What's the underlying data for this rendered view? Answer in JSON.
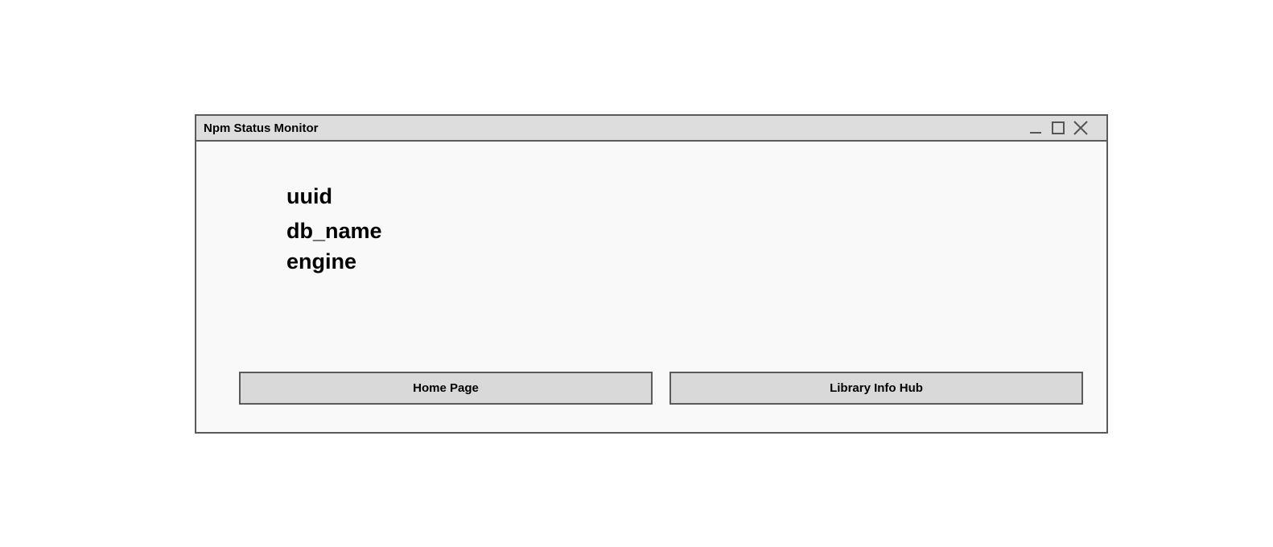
{
  "window": {
    "title": "Npm Status Monitor",
    "controls": {
      "minimize_icon": "minimize-icon",
      "maximize_icon": "maximize-icon",
      "close_icon": "close-icon"
    }
  },
  "main": {
    "fields": [
      "uuid",
      "db_name",
      "engine"
    ]
  },
  "buttons": {
    "home_label": "Home Page",
    "library_label": "Library Info Hub"
  },
  "colors": {
    "titlebar_bg": "#dddddd",
    "window_bg": "#f9f9f9",
    "border": "#5a5a5a",
    "button_bg": "#d9d9d9"
  }
}
